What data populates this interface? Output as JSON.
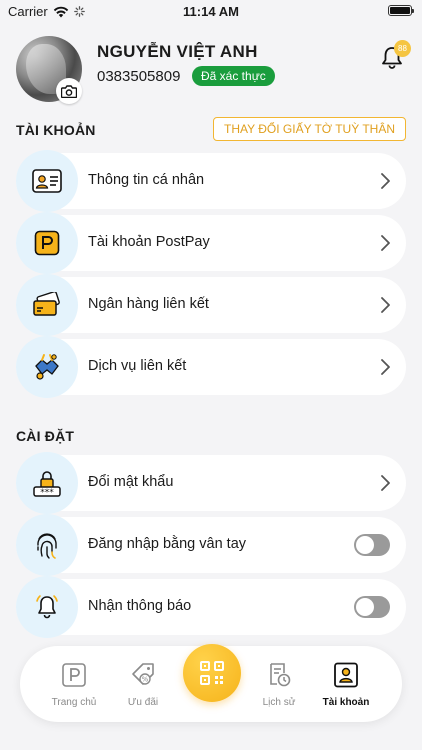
{
  "status": {
    "carrier": "Carrier",
    "time": "11:14 AM"
  },
  "profile": {
    "name": "NGUYỄN VIỆT ANH",
    "phone": "0383505809",
    "verified_badge": "Đã xác thực",
    "notification_count": "88"
  },
  "account_section": {
    "title": "TÀI KHOẢN",
    "change_id_button": "THAY ĐỔI GIẤY TỜ TUỲ THÂN",
    "items": [
      {
        "label": "Thông tin cá nhân",
        "icon": "id-card-icon"
      },
      {
        "label": "Tài khoản PostPay",
        "icon": "postpay-icon"
      },
      {
        "label": "Ngân hàng liên kết",
        "icon": "bank-card-icon"
      },
      {
        "label": "Dịch vụ liên kết",
        "icon": "linked-services-icon"
      }
    ]
  },
  "settings_section": {
    "title": "CÀI ĐẶT",
    "items": [
      {
        "label": "Đổi mật khẩu",
        "icon": "password-lock-icon",
        "control": "chevron"
      },
      {
        "label": "Đăng nhập bằng vân tay",
        "icon": "fingerprint-icon",
        "control": "toggle",
        "enabled": false
      },
      {
        "label": "Nhận thông báo",
        "icon": "bell-icon",
        "control": "toggle",
        "enabled": false
      }
    ]
  },
  "tab_bar": {
    "tabs": [
      {
        "label": "Trang chủ",
        "icon": "home-p-icon"
      },
      {
        "label": "Ưu đãi",
        "icon": "voucher-icon"
      },
      {
        "label": "",
        "icon": "qr-scan-icon"
      },
      {
        "label": "Lịch sử",
        "icon": "history-icon"
      },
      {
        "label": "Tài khoản",
        "icon": "account-icon",
        "active": true
      }
    ]
  },
  "colors": {
    "accent_yellow": "#f6b31a",
    "verified_green": "#1a9d3d",
    "icon_bg_blue": "#e4f3fc",
    "background": "#f4f4f6"
  }
}
